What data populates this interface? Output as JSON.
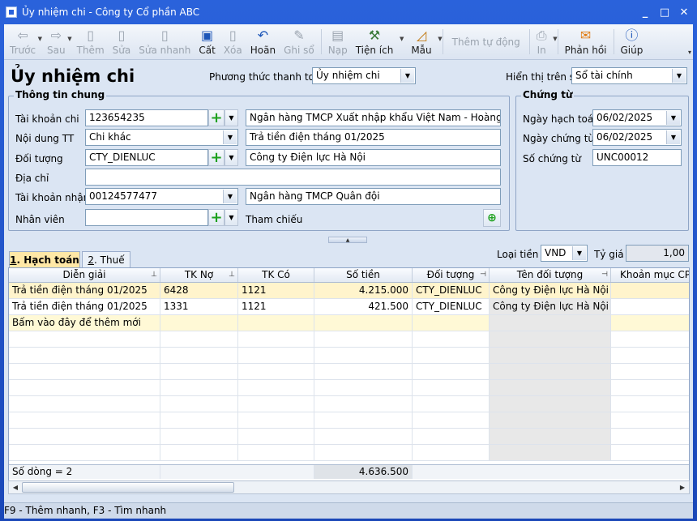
{
  "window": {
    "title": "Ủy nhiệm chi - Công ty Cổ phần ABC",
    "controls": [
      "_",
      "□",
      "✕"
    ]
  },
  "toolbar": {
    "buttons": [
      {
        "label": "Trước",
        "icon": "arrow-left-icon",
        "disabled": true
      },
      {
        "label": "Sau",
        "icon": "arrow-right-icon",
        "disabled": true
      },
      {
        "label": "Thêm",
        "icon": "add-document-icon",
        "disabled": true
      },
      {
        "label": "Sửa",
        "icon": "edit-document-icon",
        "disabled": true
      },
      {
        "label": "Sửa nhanh",
        "icon": "quick-edit-icon",
        "disabled": true
      },
      {
        "label": "Cất",
        "icon": "save-icon",
        "disabled": false
      },
      {
        "label": "Xóa",
        "icon": "delete-icon",
        "disabled": true
      },
      {
        "label": "Hoãn",
        "icon": "undo-icon",
        "disabled": false
      },
      {
        "label": "Ghi sổ",
        "icon": "pencil-icon",
        "disabled": true
      },
      {
        "label": "Nạp",
        "icon": "reload-icon",
        "disabled": true
      },
      {
        "label": "Tiện ích",
        "icon": "tools-icon",
        "disabled": false
      },
      {
        "label": "Mẫu",
        "icon": "template-icon",
        "disabled": false
      },
      {
        "label": "Thêm tự động",
        "disabled": true
      },
      {
        "label": "In",
        "icon": "print-icon",
        "disabled": true
      },
      {
        "label": "Phản hồi",
        "icon": "mail-icon",
        "disabled": false
      },
      {
        "label": "Giúp",
        "icon": "help-icon",
        "disabled": false
      }
    ]
  },
  "form": {
    "title": "Ủy nhiệm chi",
    "payment_method_label": "Phương thức thanh toán",
    "payment_method_value": "Ủy nhiệm chi",
    "ledger_label": "Hiển thị trên sổ",
    "ledger_value": "Sổ tài chính"
  },
  "general": {
    "group_title": "Thông tin chung",
    "account_label": "Tài khoản chi",
    "account_value": "123654235",
    "account_bank": "Ngân hàng TMCP Xuất nhập khẩu Việt Nam - Hoàng Quốc V",
    "content_label": "Nội dung TT",
    "content_value": "Chi khác",
    "content_desc": "Trả tiền điện tháng 01/2025",
    "object_label": "Đối tượng",
    "object_value": "CTY_DIENLUC",
    "object_name": "Công ty Điện lực Hà Nội",
    "address_label": "Địa chỉ",
    "address_value": "",
    "recv_account_label": "Tài khoản nhận",
    "recv_account_value": "00124577477",
    "recv_bank": "Ngân hàng TMCP Quân đội",
    "staff_label": "Nhân viên",
    "staff_value": "",
    "reference_label": "Tham chiếu"
  },
  "voucher": {
    "group_title": "Chứng từ",
    "posting_date_label": "Ngày hạch toán",
    "posting_date": "06/02/2025",
    "voucher_date_label": "Ngày chứng từ",
    "voucher_date": "06/02/2025",
    "voucher_no_label": "Số chứng từ",
    "voucher_no": "UNC00012"
  },
  "currency": {
    "label": "Loại tiền",
    "value": "VND",
    "rate_label": "Tỷ giá",
    "rate_value": "1,00"
  },
  "tabs": [
    {
      "key": "1",
      "label": ". Hạch toán",
      "active": true
    },
    {
      "key": "2",
      "label": ". Thuế",
      "active": false
    }
  ],
  "grid": {
    "columns": [
      "Diễn giải",
      "TK Nợ",
      "TK Có",
      "Số tiền",
      "Đối tượng",
      "Tên đối tượng",
      "Khoản mục CP"
    ],
    "rows": [
      [
        "Trả tiền điện tháng 01/2025",
        "6428",
        "1121",
        "4.215.000",
        "CTY_DIENLUC",
        "Công ty Điện lực Hà Nội",
        ""
      ],
      [
        "Trả tiền điện tháng 01/2025",
        "1331",
        "1121",
        "421.500",
        "CTY_DIENLUC",
        "Công ty Điện lực Hà Nội",
        ""
      ]
    ],
    "new_row_hint": "Bấm vào đây để thêm mới",
    "footer_count": "Số dòng = 2",
    "footer_total": "4.636.500"
  },
  "status_bar": "F9 - Thêm nhanh, F3 - Tìm nhanh"
}
